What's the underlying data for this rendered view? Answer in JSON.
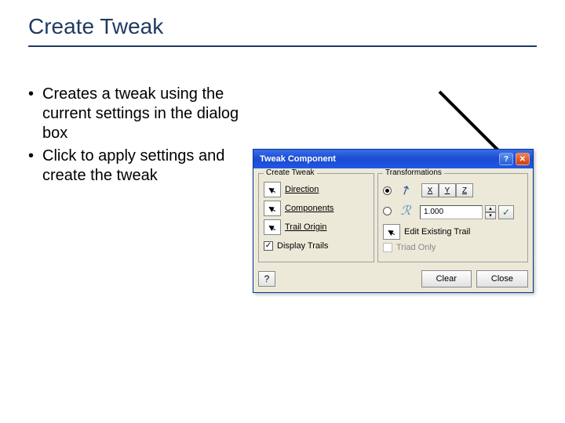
{
  "slide": {
    "title": "Create Tweak",
    "bullets": [
      "Creates a tweak using the current settings in the dialog box",
      "Click to apply settings and create the tweak"
    ]
  },
  "dialog": {
    "title": "Tweak Component",
    "group_create_label": "Create Tweak",
    "direction_label": "Direction",
    "components_label": "Components",
    "trail_origin_label": "Trail Origin",
    "display_trails_label": "Display Trails",
    "group_trans_label": "Transformations",
    "axis_x": "X",
    "axis_y": "Y",
    "axis_z": "Z",
    "distance_value": "1.000",
    "edit_trail_label": "Edit Existing Trail",
    "triad_only_label": "Triad Only",
    "clear_label": "Clear",
    "close_label": "Close",
    "help_symbol": "?",
    "checkmark": "✓",
    "spin_up": "▴",
    "spin_down": "▾",
    "tb_help": "?",
    "tb_close": "✕"
  }
}
